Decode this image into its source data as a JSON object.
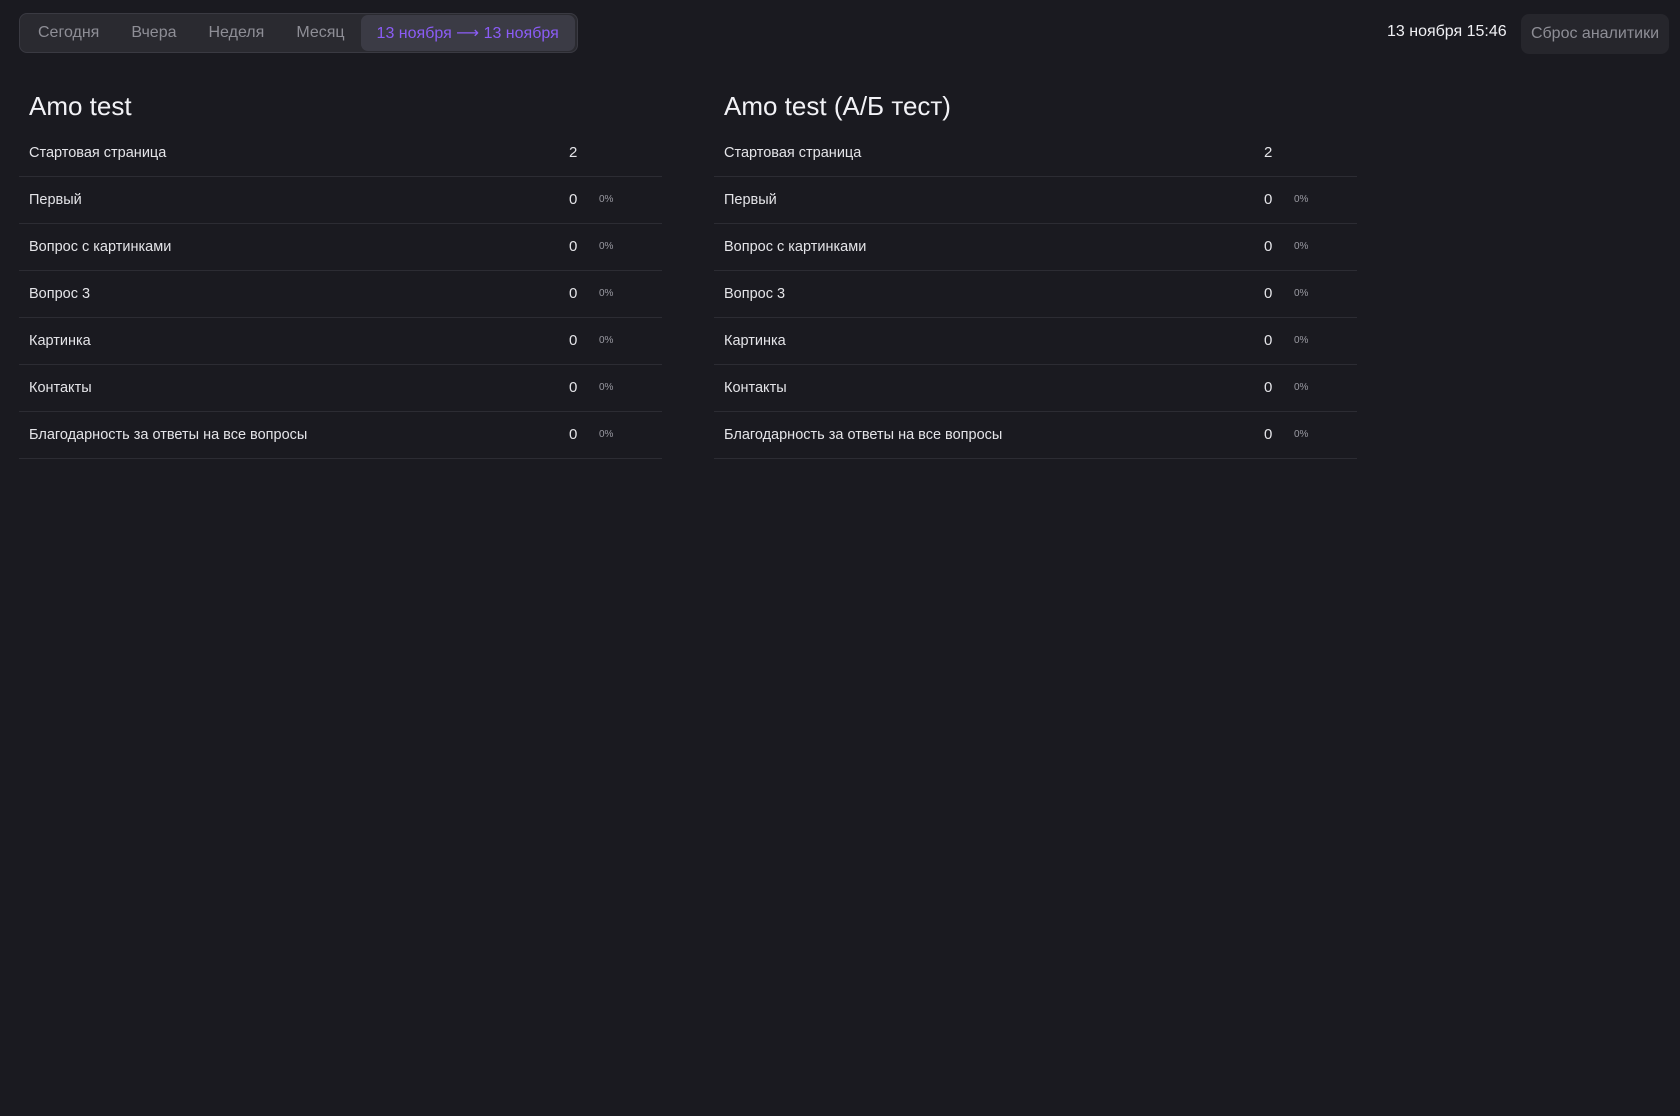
{
  "period_switcher": {
    "tabs": [
      {
        "label": "Сегодня",
        "active": false
      },
      {
        "label": "Вчера",
        "active": false
      },
      {
        "label": "Неделя",
        "active": false
      },
      {
        "label": "Месяц",
        "active": false
      },
      {
        "label": "13 ноября ⟶ 13 ноября",
        "active": true
      }
    ]
  },
  "header": {
    "datetime": "13 ноября 15:46",
    "reset_label": "Сброс аналитики"
  },
  "colors": {
    "background": "#1a1a20",
    "accent": "#8b5cf6"
  },
  "panels": [
    {
      "title": "Amo test",
      "rows": [
        {
          "label": "Стартовая страница",
          "count": "2",
          "percent": ""
        },
        {
          "label": "Первый",
          "count": "0",
          "percent": "0%"
        },
        {
          "label": "Вопрос с картинками",
          "count": "0",
          "percent": "0%"
        },
        {
          "label": "Вопрос 3",
          "count": "0",
          "percent": "0%"
        },
        {
          "label": "Картинка",
          "count": "0",
          "percent": "0%"
        },
        {
          "label": "Контакты",
          "count": "0",
          "percent": "0%"
        },
        {
          "label": "Благодарность за ответы на все вопросы",
          "count": "0",
          "percent": "0%"
        }
      ]
    },
    {
      "title": "Amo test (А/Б тест)",
      "rows": [
        {
          "label": "Стартовая страница",
          "count": "2",
          "percent": ""
        },
        {
          "label": "Первый",
          "count": "0",
          "percent": "0%"
        },
        {
          "label": "Вопрос с картинками",
          "count": "0",
          "percent": "0%"
        },
        {
          "label": "Вопрос 3",
          "count": "0",
          "percent": "0%"
        },
        {
          "label": "Картинка",
          "count": "0",
          "percent": "0%"
        },
        {
          "label": "Контакты",
          "count": "0",
          "percent": "0%"
        },
        {
          "label": "Благодарность за ответы на все вопросы",
          "count": "0",
          "percent": "0%"
        }
      ]
    }
  ]
}
